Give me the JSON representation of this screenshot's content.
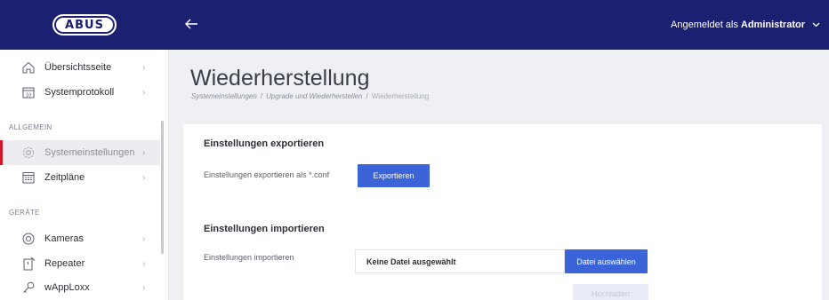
{
  "header": {
    "logo_text": "ABUS",
    "back_icon": "arrow-left-icon",
    "user_prefix": "Angemeldet als",
    "user_name": "Administrator",
    "user_menu_icon": "chevron-down-icon"
  },
  "sidebar": {
    "items_top": [
      {
        "label": "Übersichtsseite",
        "icon": "home-icon"
      },
      {
        "label": "Systemprotokoll",
        "icon": "calendar-icon"
      }
    ],
    "section_general": "ALLGEMEIN",
    "items_general": [
      {
        "label": "Systemeinstellungen",
        "icon": "gear-icon",
        "active": true
      },
      {
        "label": "Zeitpläne",
        "icon": "schedule-icon"
      }
    ],
    "section_devices": "GERÄTE",
    "items_devices": [
      {
        "label": "Kameras",
        "icon": "camera-icon"
      },
      {
        "label": "Repeater",
        "icon": "repeater-icon"
      },
      {
        "label": "wAppLoxx",
        "icon": "key-icon"
      }
    ],
    "active_color": "#d0192b"
  },
  "main": {
    "title": "Wiederherstellung",
    "breadcrumb": {
      "level1": "Systemeinstellungen",
      "level2": "Upgrade und Wiederherstellen",
      "current": "Wiederherstellung",
      "separator": "/"
    },
    "export": {
      "title": "Einstellungen exportieren",
      "label": "Einstellungen exportieren als *.conf",
      "button": "Exportieren"
    },
    "import": {
      "title": "Einstellungen importieren",
      "label": "Einstellungen importieren",
      "file_placeholder": "Keine Datei ausgewählt",
      "choose_button": "Datei auswählen",
      "upload_button": "Hochladen"
    }
  },
  "colors": {
    "header_bg": "#1b2070",
    "primary_button": "#3b64d8",
    "page_bg": "#eef0f4"
  }
}
